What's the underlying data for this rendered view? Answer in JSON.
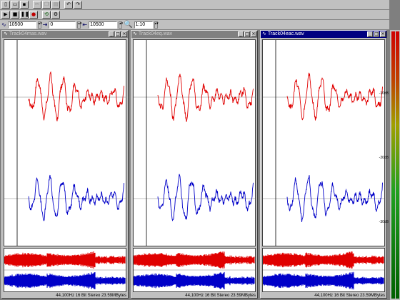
{
  "toolbar": {
    "row1_icons": [
      "new-icon",
      "open-icon",
      "save-icon",
      "cut-icon",
      "copy-icon",
      "paste-icon",
      "undo-icon",
      "redo-icon"
    ],
    "row2_icons": [
      "play-icon",
      "stop-icon",
      "pause-icon",
      "record-icon",
      "loop-icon",
      "settings-icon"
    ],
    "field1": "10500",
    "field2": "0",
    "field3": "10500",
    "zoom": "1:10"
  },
  "windows": [
    {
      "title": "Track04mas.wav",
      "status": "44,100Hz 16 Bit Stereo 23.59MBytes"
    },
    {
      "title": "Track04eq.wav",
      "status": "44,100Hz 16 Bit Stereo 23.59MBytes"
    },
    {
      "title": "Track04eac.wav",
      "status": "44,100Hz 16 Bit Stereo 23.59MBytes"
    }
  ],
  "meter": {
    "labels": [
      "-10dB",
      "-20dB",
      "-30dB"
    ]
  },
  "colors": {
    "left_channel": "#e00000",
    "right_channel": "#0000c8",
    "titlebar_active": "#000080"
  }
}
